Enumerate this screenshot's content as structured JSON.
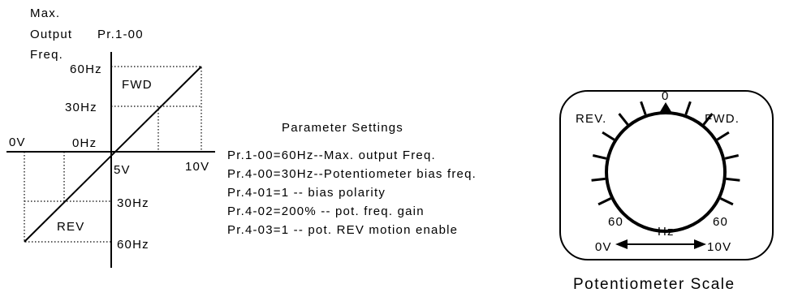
{
  "graph": {
    "ylabel_lines": [
      "Max.",
      "Output",
      "Freq."
    ],
    "param_ref": "Pr.1-00",
    "fwd_label": "FWD",
    "rev_label": "REV",
    "y_ticks": {
      "top_60": "60Hz",
      "top_30": "30Hz",
      "zero": "0Hz",
      "bottom_30": "30Hz",
      "bottom_60": "60Hz"
    },
    "x_ticks": {
      "left": "0V",
      "mid": "5V",
      "right": "10V"
    }
  },
  "settings": {
    "title": "Parameter Settings",
    "lines": [
      "Pr.1-00=60Hz--Max. output Freq.",
      "Pr.4-00=30Hz--Potentiometer bias freq.",
      "Pr.4-01=1 -- bias polarity",
      "Pr.4-02=200% -- pot. freq. gain",
      "Pr.4-03=1 -- pot. REV motion enable"
    ]
  },
  "dial": {
    "top": "0",
    "rev": "REV.",
    "fwd": "FWD.",
    "left_value": "60",
    "right_value": "60",
    "unit": "Hz",
    "left_voltage": "0V",
    "right_voltage": "10V",
    "caption": "Potentiometer Scale"
  }
}
